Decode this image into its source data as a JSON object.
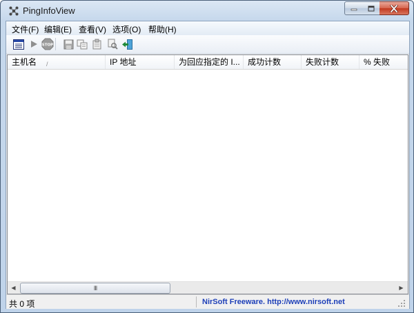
{
  "window": {
    "title": "PingInfoView"
  },
  "menu": [
    "文件(F)",
    "编辑(E)",
    "查看(V)",
    "选项(O)",
    "帮助(H)"
  ],
  "toolbar": [
    {
      "icon": "properties-icon"
    },
    {
      "icon": "start-ping-icon"
    },
    {
      "icon": "stop-icon",
      "label": "STOP"
    },
    {
      "icon": "save-icon"
    },
    {
      "icon": "copy-icon"
    },
    {
      "icon": "html-report-icon"
    },
    {
      "icon": "find-icon"
    },
    {
      "icon": "exit-icon"
    }
  ],
  "columns": [
    "主机名",
    "IP 地址",
    "为回应指定的 I...",
    "成功计数",
    "失败计数",
    "% 失败"
  ],
  "rows": [],
  "scrollbar": {
    "thumb_grip": "III"
  },
  "status": {
    "count": "共 0 项",
    "brand": "NirSoft Freeware.  http://www.nirsoft.net"
  },
  "colors": {
    "brand_link": "#1d3fb8",
    "exit_green": "#1f8a3a"
  }
}
